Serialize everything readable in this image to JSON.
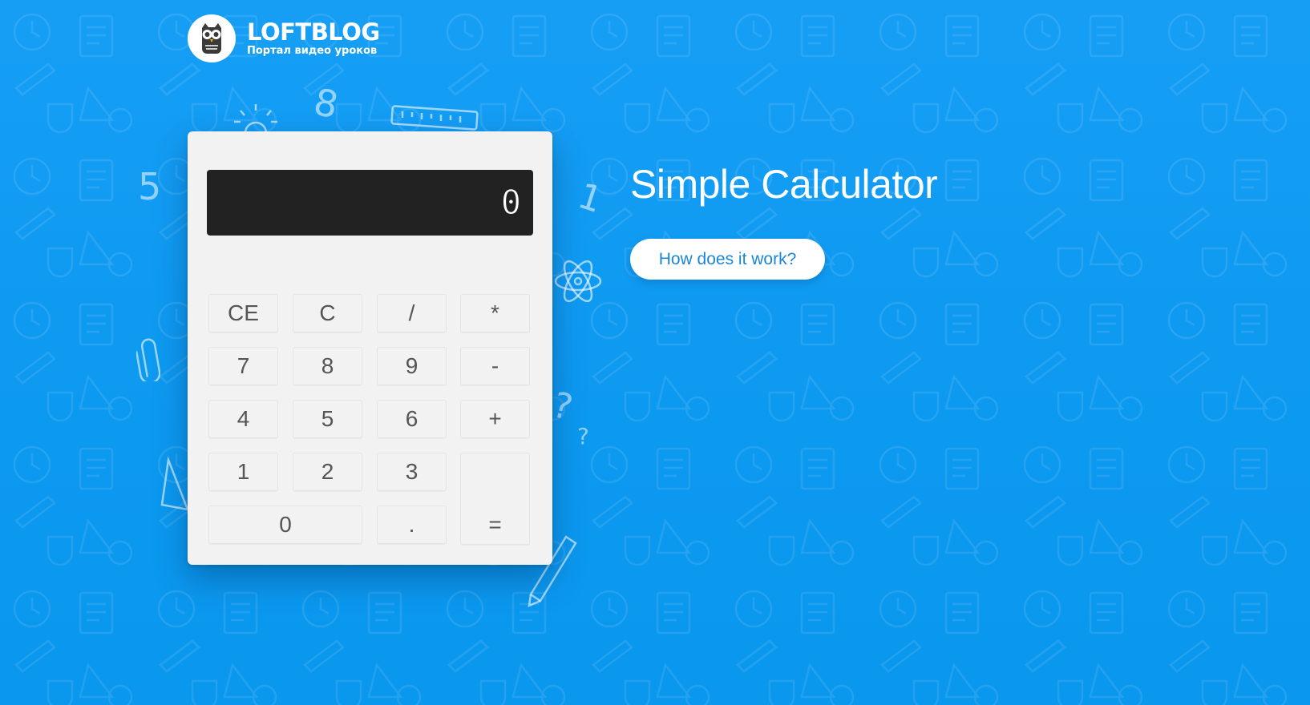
{
  "logo": {
    "name": "LOFTBLOG",
    "tagline": "Портал видео уроков"
  },
  "calculator": {
    "display_value": "0",
    "keys": {
      "ce": "CE",
      "c": "C",
      "divide": "/",
      "multiply": "*",
      "seven": "7",
      "eight": "8",
      "nine": "9",
      "minus": "-",
      "four": "4",
      "five": "5",
      "six": "6",
      "plus": "+",
      "one": "1",
      "two": "2",
      "three": "3",
      "zero": "0",
      "dot": ".",
      "equals": "="
    }
  },
  "main": {
    "title": "Simple Calculator",
    "how_button_label": "How does it work?"
  },
  "colors": {
    "background": "#0f9cf2",
    "button_text": "#1a86d6",
    "display": "#222222",
    "calculator_body": "#f2f2f2"
  }
}
